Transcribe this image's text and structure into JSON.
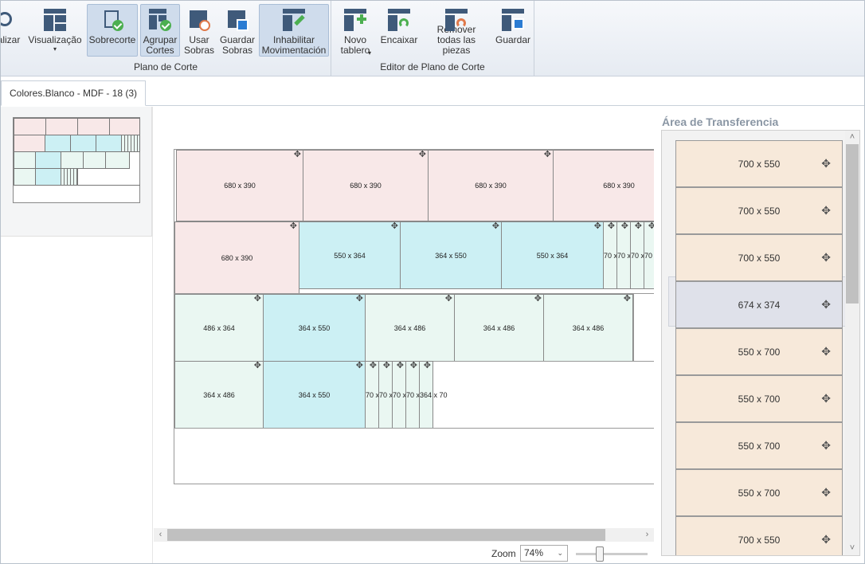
{
  "ribbon": {
    "buttons": [
      {
        "name": "atualizar-button",
        "label": "alizar",
        "icon": "refresh-icon"
      },
      {
        "name": "visualizacao-button",
        "label": "Visualização",
        "icon": "view-icon",
        "dropdown": "▾"
      },
      {
        "name": "sobrecorte-button",
        "label": "Sobrecorte",
        "icon": "overcut-icon"
      },
      {
        "name": "agrupar-cortes-button",
        "label": "Agrupar\nCortes",
        "icon": "group-cuts-icon"
      },
      {
        "name": "usar-sobras-button",
        "label": "Usar\nSobras",
        "icon": "use-leftovers-icon"
      },
      {
        "name": "guardar-sobras-button",
        "label": "Guardar\nSobras",
        "icon": "save-leftovers-icon"
      },
      {
        "name": "habilitar-movimentacao-button",
        "label": "Inhabilitar\nMovimentación",
        "icon": "toggle-move-icon"
      },
      {
        "name": "novo-tableiro-button",
        "label": "Novo\ntablero",
        "icon": "new-board-icon",
        "dropdown": "▾"
      },
      {
        "name": "encaixar-button",
        "label": "Encaixar",
        "icon": "fit-icon"
      },
      {
        "name": "remover-pecas-button",
        "label": "Remover\ntodas las piezas",
        "icon": "remove-pieces-icon"
      },
      {
        "name": "guardar-button",
        "label": "Guardar",
        "icon": "save-icon"
      }
    ],
    "groups": {
      "plano": "Plano de Corte",
      "editor": "Editor de Plano de Corte"
    }
  },
  "tab": {
    "label": "Colores.Blanco - MDF - 18 (3)"
  },
  "board": {
    "move_glyph": "✥",
    "pieces": [
      {
        "label": "680 x 390",
        "color": "pink"
      },
      {
        "label": "680 x 390",
        "color": "pink"
      },
      {
        "label": "680 x 390",
        "color": "pink"
      },
      {
        "label": "680 x 390",
        "color": "pink"
      },
      {
        "label": "680 x 390",
        "color": "pink"
      },
      {
        "label": "550 x 364",
        "color": "cyan"
      },
      {
        "label": "364 x 550",
        "color": "cyan"
      },
      {
        "label": "550 x 364",
        "color": "cyan"
      },
      {
        "label": "70 x",
        "color": "mint"
      },
      {
        "label": "70 x",
        "color": "mint"
      },
      {
        "label": "70 x",
        "color": "mint"
      },
      {
        "label": "70 x",
        "color": "mint"
      },
      {
        "label": "486 x 364",
        "color": "mint"
      },
      {
        "label": "364 x 550",
        "color": "cyan"
      },
      {
        "label": "364 x 486",
        "color": "mint"
      },
      {
        "label": "364 x 486",
        "color": "mint"
      },
      {
        "label": "364 x 486",
        "color": "mint"
      },
      {
        "label": "364 x 486",
        "color": "mint"
      },
      {
        "label": "364 x 550",
        "color": "cyan"
      },
      {
        "label": "70 x",
        "color": "mint"
      },
      {
        "label": "70 x",
        "color": "mint"
      },
      {
        "label": "70 x",
        "color": "mint"
      },
      {
        "label": "70 x",
        "color": "mint"
      },
      {
        "label": "364 x 70",
        "color": "mint"
      }
    ]
  },
  "zoom": {
    "label": "Zoom",
    "value": "74%",
    "chevron": "⌄"
  },
  "scroll": {
    "left": "‹",
    "right": "›",
    "up": "˄",
    "down": "˅"
  },
  "transfer": {
    "title": "Área de Transferencia",
    "move_glyph": "✥",
    "items": [
      {
        "label": "700 x 550"
      },
      {
        "label": "700 x 550"
      },
      {
        "label": "700 x 550"
      },
      {
        "label": "674 x 374"
      },
      {
        "label": "550 x 700"
      },
      {
        "label": "550 x 700"
      },
      {
        "label": "550 x 700"
      },
      {
        "label": "550 x 700"
      },
      {
        "label": "700 x 550"
      }
    ]
  }
}
